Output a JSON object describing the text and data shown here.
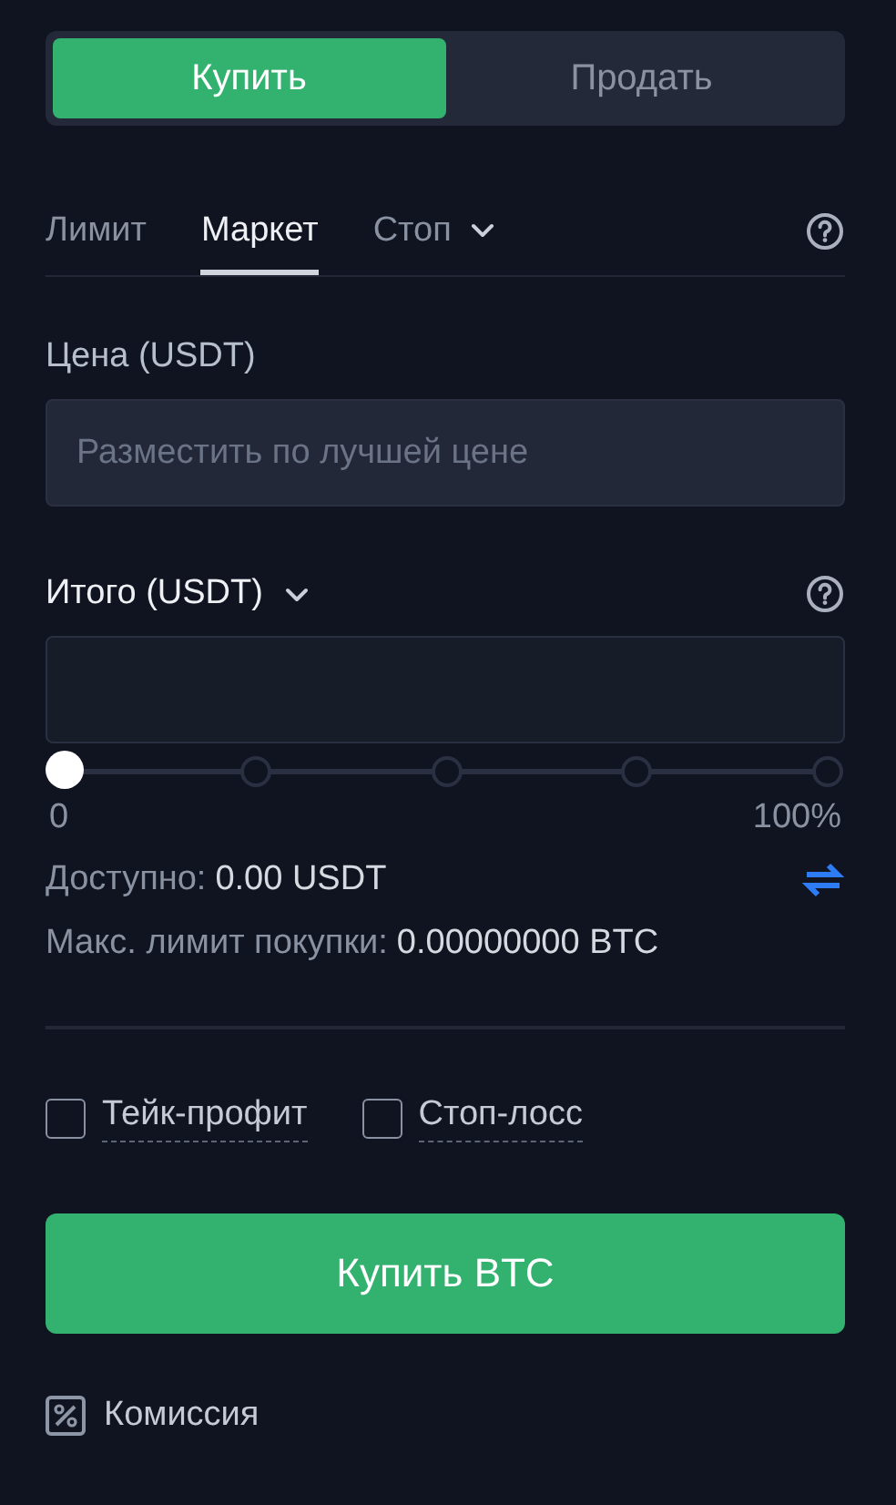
{
  "side_tabs": [
    {
      "label": "Купить",
      "selected": true
    },
    {
      "label": "Продать",
      "selected": false
    }
  ],
  "order_tabs": [
    {
      "label": "Лимит",
      "selected": false,
      "dropdown": false
    },
    {
      "label": "Маркет",
      "selected": true,
      "dropdown": false
    },
    {
      "label": "Стоп",
      "selected": false,
      "dropdown": true
    }
  ],
  "price": {
    "label": "Цена (USDT)",
    "placeholder": "Разместить по лучшей цене"
  },
  "total": {
    "label": "Итого (USDT)"
  },
  "slider": {
    "level": 0,
    "min_label": "0",
    "max_label": "100%"
  },
  "available": {
    "label": "Доступно:",
    "value": "0.00 USDT"
  },
  "max_buy": {
    "label": "Макс. лимит покупки:",
    "value": "0.00000000 BTC"
  },
  "options": [
    {
      "label": "Тейк-профит",
      "checked": false
    },
    {
      "label": "Стоп-лосс",
      "checked": false
    }
  ],
  "submit": {
    "label": "Купить BTC"
  },
  "fee": {
    "label": "Комиссия"
  }
}
